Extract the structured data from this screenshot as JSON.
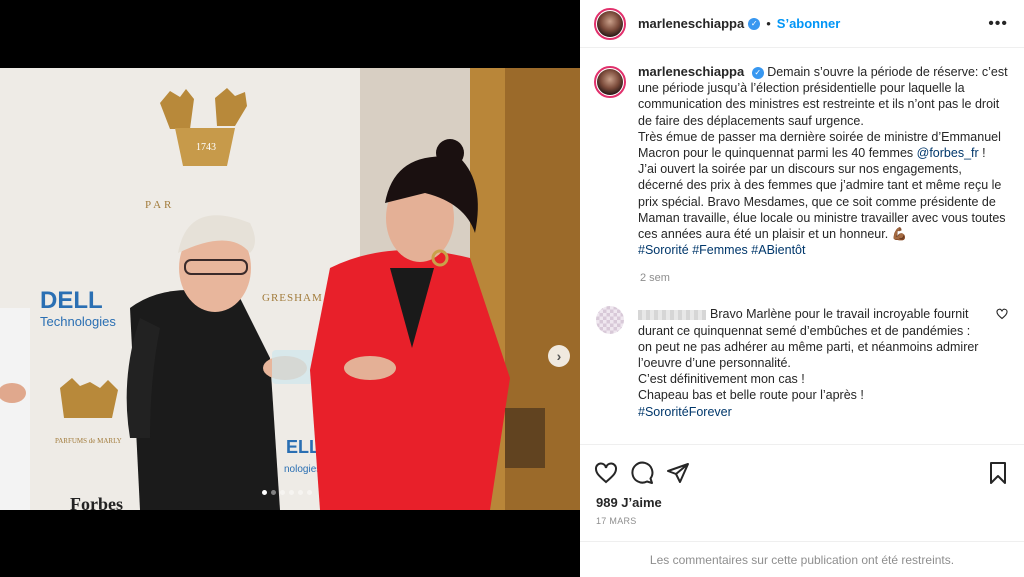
{
  "post": {
    "username": "marleneschiappa",
    "follow_label": "S’abonner",
    "separator": "•",
    "more_label": "•••"
  },
  "caption": {
    "username": "marleneschiappa",
    "text_1": "Demain s’ouvre la période de réserve: c’est une période jusqu’à l’élection présidentielle pour laquelle la communication des ministres est restreinte et ils n’ont pas le droit de faire des déplacements sauf urgence.",
    "text_2a": "Très émue de passer ma dernière soirée de ministre d’Emmanuel Macron pour le quinquennat parmi les 40 femmes",
    "mention": "@forbes_fr",
    "text_2b": "!",
    "text_3": "J’ai ouvert la soirée par un discours sur nos engagements, décerné des prix à des femmes que j’admire tant et même reçu le prix spécial. Bravo Mesdames, que ce soit comme présidente de Maman travaille, élue locale ou ministre travailler avec vous toutes ces années aura été un plaisir et un honneur. 💪🏾",
    "hashtags": [
      "#Sororité",
      "#Femmes",
      "#ABientôt"
    ],
    "time_ago": "2 sem"
  },
  "comment": {
    "line_1": "Bravo Marlène pour le travail incroyable fournit durant ce quinquennat semé d’embûches et de pandémies : on peut ne pas adhérer au même parti, et néanmoins admirer l’oeuvre d’une personnalité.",
    "line_2": "C’est définitivement mon cas !",
    "line_3": "Chapeau bas et belle route pour l’après !",
    "hashtag": "#SororitéForever"
  },
  "actions": {
    "likes": "989 J’aime",
    "date": "17 MARS",
    "restricted": "Les commentaires sur cette publication ont été restreints."
  },
  "carousel": {
    "total_slides": 6,
    "active_index": 0,
    "next_label": "›"
  },
  "photo_text": {
    "brand_dell_1": "DELL",
    "brand_dell_2": "Technologies",
    "brand_parfums": "PARFUMS de MARLY",
    "brand_gresham": "GRESHAM",
    "brand_year": "1743",
    "brand_forbes": "Forbes"
  },
  "colors": {
    "accent_blue": "#0095f6",
    "link_dark": "#00376b",
    "verified": "#3897f0",
    "jacket_red": "#e8202a",
    "brand_gold": "#b8893a"
  }
}
